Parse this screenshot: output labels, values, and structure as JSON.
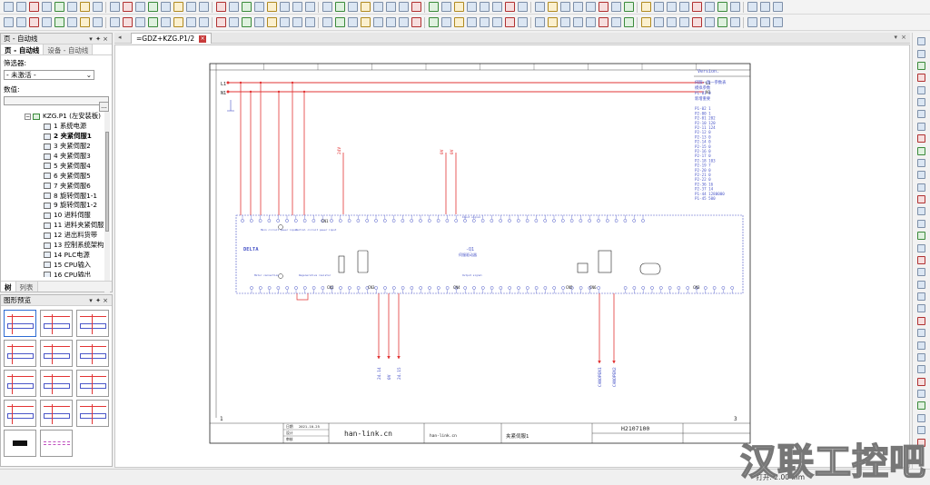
{
  "window": {
    "document_tab": "=GDZ+KZG.P1/2"
  },
  "pages_panel": {
    "title": "页 - 自动线",
    "tabs": [
      "页 - 自动线",
      "设备 - 自动线"
    ],
    "filter_label": "筛选器:",
    "filter_value": "- 未激活 -",
    "filter_button": "...",
    "value_label": "数值:",
    "tree": {
      "root": "KZG.P1 (左安装板)",
      "items": [
        "1 系统电源",
        "2 夹紧伺服1",
        "3 夹紧伺服2",
        "4 夹紧伺服3",
        "5 夹紧伺服4",
        "6 夹紧伺服5",
        "7 夹紧伺服6",
        "8 旋转伺服1-1",
        "9 旋转伺服1-2",
        "10 进料伺服",
        "11 进料夹紧伺服",
        "12 进出料货带",
        "13 控制系统架构",
        "14 PLC电源",
        "15 CPU输入",
        "16 CPU输出"
      ],
      "selected_index": 1
    },
    "bottom_tabs": [
      "树",
      "列表"
    ]
  },
  "preview_panel": {
    "title": "图形预览"
  },
  "drawing": {
    "version_label": "Version.",
    "params_header1": "伺服一面一参数表",
    "params_header2": "模拟参数",
    "params_header3": "新增重要",
    "params": [
      "P1-01    0",
      "P1-02    1",
      "P2-00    1",
      "P2-01    202",
      "P2-10    120",
      "P2-11    124",
      "P2-12    0",
      "P2-13    0",
      "P2-14    0",
      "P2-15    0",
      "P2-16    0",
      "P2-17    0",
      "P2-18    103",
      "P2-19    7",
      "P2-20    0",
      "P2-21    0",
      "P2-22    0",
      "P2-36    16",
      "P2-37    14",
      "P1-44    1280000",
      "P1-45    500"
    ],
    "line_labels": [
      "L1",
      "N1"
    ],
    "right_labels": [
      "L1",
      "N1"
    ],
    "vertical_labels_top": [
      "24V",
      "0V",
      "0V"
    ],
    "vertical_labels_bottom": [
      "24.14",
      "0V",
      "24.15"
    ],
    "can_labels": [
      "CANOPEN1",
      "CANOPEN2"
    ],
    "device_label": "-Q1",
    "device_sub": "伺服驱动器",
    "brand": "DELTA",
    "cn_labels": [
      "CN1",
      "CN2",
      "CN3",
      "CN4",
      "CN5",
      "CN6",
      "CN3"
    ],
    "section_labels": [
      "Main circuit power input",
      "Control circuit power input",
      "Input signal",
      "Motor connection",
      "Regenerative resistor",
      "Output signal"
    ],
    "title_block": {
      "company": "han-link.cn",
      "company_small": "han-link.cn",
      "drawing_no": "H2107100",
      "page_title": "夹紧伺服1",
      "page_no": "3",
      "left_no": "1",
      "design_label": "设计",
      "date_label": "日期",
      "check_label": "审核",
      "date_value": "2021-10-25"
    }
  },
  "status_bar": {
    "text": "打开: 2.00 mm"
  },
  "watermark": "汉联工控吧",
  "colors": {
    "wire_red": "#e23434",
    "device_blue": "#4b57c8",
    "border_black": "#222222"
  }
}
